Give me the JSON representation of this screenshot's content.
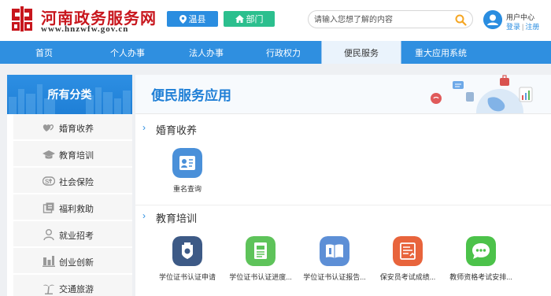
{
  "header": {
    "site_title": "河南政务服务网",
    "site_domain": "www.hnzwfw.gov.cn",
    "location_label": "温县",
    "department_label": "部门",
    "search": {
      "placeholder": "请输入您想了解的内容"
    },
    "user_center": "用户中心",
    "login": "登录",
    "register": "注册"
  },
  "colors": {
    "brand_red": "#c8161d",
    "nav_blue": "#2f8fe0",
    "accent_green": "#2cbf8e",
    "search_orange": "#f5a623"
  },
  "nav": {
    "items": [
      {
        "label": "首页"
      },
      {
        "label": "个人办事"
      },
      {
        "label": "法人办事"
      },
      {
        "label": "行政权力"
      },
      {
        "label": "便民服务",
        "active": true
      },
      {
        "label": "重大应用系统"
      }
    ]
  },
  "sidebar": {
    "title": "所有分类",
    "items": [
      {
        "label": "婚育收养",
        "icon": "hearts-icon"
      },
      {
        "label": "教育培训",
        "icon": "graduation-cap-icon"
      },
      {
        "label": "社会保险",
        "icon": "social-insurance-icon"
      },
      {
        "label": "福利救助",
        "icon": "welfare-icon"
      },
      {
        "label": "就业招考",
        "icon": "person-icon"
      },
      {
        "label": "创业创新",
        "icon": "innovation-icon"
      },
      {
        "label": "交通旅游",
        "icon": "palm-tree-icon"
      }
    ]
  },
  "main": {
    "title": "便民服务应用",
    "sections": [
      {
        "title": "婚育收养",
        "apps": [
          {
            "label": "重名查询",
            "icon": "id-card-icon",
            "color": "#4a90d9"
          }
        ]
      },
      {
        "title": "教育培训",
        "apps": [
          {
            "label": "学位证书认证申请",
            "icon": "badge-icon",
            "color": "#3d5a86"
          },
          {
            "label": "学位证书认证进度...",
            "icon": "document-icon",
            "color": "#5ec35a"
          },
          {
            "label": "学位证书认证报告...",
            "icon": "book-icon",
            "color": "#5d8fd6"
          },
          {
            "label": "保安员考试成绩...",
            "icon": "score-sheet-icon",
            "color": "#e8643c"
          },
          {
            "label": "教师资格考试安排...",
            "icon": "chat-bubble-icon",
            "color": "#4cc24a"
          }
        ]
      }
    ]
  }
}
